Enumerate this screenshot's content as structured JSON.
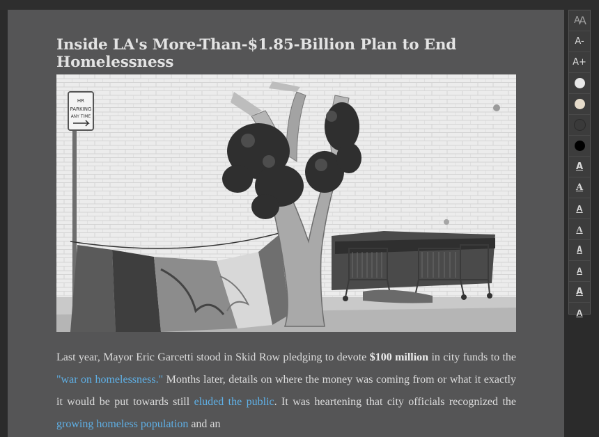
{
  "article": {
    "title": "Inside LA's More-Than-$1.85-Billion Plan to End Homelessness",
    "paragraph": {
      "s1": "Last year, Mayor Eric Garcetti stood in Skid Row pledging to devote ",
      "b1": "$100 million",
      "s2": " in city funds to the ",
      "l1": "\"war on homelessness.\"",
      "s3": " Months later, details on where the money was coming from or what it exactly it would be put towards still ",
      "l2": "eluded the public",
      "s4": ". It was heartening that city officials recognized the ",
      "l3": "growing homeless population",
      "s5": " and an"
    },
    "photo": {
      "sign_line1": "HR",
      "sign_line2": "PARKING",
      "sign_line3": "ANY TIME"
    }
  },
  "sidebar": {
    "font_size_label_small": "A",
    "font_size_label_big": "A",
    "decrease_label": "A-",
    "increase_label": "A+",
    "themes": [
      "#e8e8e8",
      "#e6dccb",
      "#3a3a3a",
      "#000000"
    ],
    "font_buttons": [
      "A",
      "A",
      "A",
      "A",
      "A",
      "A",
      "A",
      "A"
    ]
  }
}
